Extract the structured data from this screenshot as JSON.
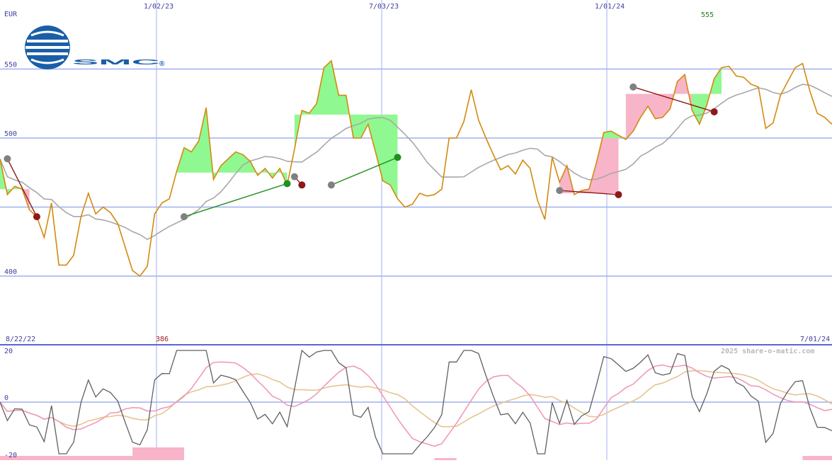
{
  "colors": {
    "price": "#d38a0e",
    "avg": "#a8a8a8",
    "up_fill": "#90f890",
    "down_fill": "#f8b4c8",
    "up_line": "#209020",
    "down_line": "#901818",
    "grid": "#a0b0f0",
    "label_blue": "#4040a0",
    "osc_dark": "#606060",
    "osc_pink": "#f09ab8",
    "osc_tan": "#e6c490",
    "logo_blue": "#1a5ea8"
  },
  "header": {
    "currency": "EUR",
    "max_label": "555",
    "min_label": "386",
    "start_date": "8/22/22",
    "end_date": "7/01/24",
    "copyright": "2025 share-o-matic.com"
  },
  "logo": {
    "text": "SMC",
    "registered": "®"
  },
  "chart_data": [
    {
      "type": "line",
      "currency": "EUR",
      "x_range": [
        "2022-08-22",
        "2024-07-01"
      ],
      "x_ticks": [
        "1/02/23",
        "7/03/23",
        "1/01/24"
      ],
      "y_ticks": [
        400,
        450,
        500,
        550
      ],
      "y_tick_labels": [
        "400",
        "",
        "500",
        "550"
      ],
      "ylim": [
        350,
        600
      ],
      "grid": true,
      "series": [
        {
          "key": "price",
          "values": [
            [
              0,
              485
            ],
            [
              2,
              459
            ],
            [
              4,
              465
            ],
            [
              6,
              463
            ],
            [
              8,
              448
            ],
            [
              10,
              443
            ],
            [
              12,
              428
            ],
            [
              14,
              453
            ],
            [
              16,
              408
            ],
            [
              18,
              408
            ],
            [
              20,
              415
            ],
            [
              22,
              443
            ],
            [
              24,
              460
            ],
            [
              26,
              445
            ],
            [
              28,
              450
            ],
            [
              30,
              446
            ],
            [
              32,
              438
            ],
            [
              34,
              421
            ],
            [
              36,
              404
            ],
            [
              38,
              400
            ],
            [
              40,
              407
            ],
            [
              42,
              445
            ],
            [
              44,
              453
            ],
            [
              46,
              456
            ],
            [
              48,
              476
            ],
            [
              50,
              493
            ],
            [
              52,
              490
            ],
            [
              54,
              498
            ],
            [
              56,
              522
            ],
            [
              58,
              470
            ],
            [
              60,
              480
            ],
            [
              62,
              485
            ],
            [
              64,
              490
            ],
            [
              66,
              488
            ],
            [
              68,
              483
            ],
            [
              70,
              473
            ],
            [
              72,
              478
            ],
            [
              74,
              471
            ],
            [
              76,
              478
            ],
            [
              78,
              466
            ],
            [
              80,
              492
            ],
            [
              82,
              520
            ],
            [
              84,
              518
            ],
            [
              86,
              525
            ],
            [
              88,
              551
            ],
            [
              90,
              556
            ],
            [
              92,
              531
            ],
            [
              94,
              531
            ],
            [
              96,
              500
            ],
            [
              98,
              500
            ],
            [
              100,
              510
            ],
            [
              102,
              490
            ],
            [
              104,
              469
            ],
            [
              106,
              466
            ],
            [
              108,
              456
            ],
            [
              110,
              450
            ],
            [
              112,
              452
            ],
            [
              114,
              460
            ],
            [
              116,
              458
            ],
            [
              118,
              459
            ],
            [
              120,
              463
            ],
            [
              122,
              500
            ],
            [
              124,
              500
            ],
            [
              126,
              512
            ],
            [
              128,
              535
            ],
            [
              130,
              513
            ],
            [
              132,
              500
            ],
            [
              134,
              488
            ],
            [
              136,
              477
            ],
            [
              138,
              480
            ],
            [
              140,
              474
            ],
            [
              142,
              484
            ],
            [
              144,
              478
            ],
            [
              146,
              455
            ],
            [
              148,
              441
            ],
            [
              150,
              486
            ],
            [
              152,
              468
            ],
            [
              154,
              480
            ],
            [
              156,
              459
            ],
            [
              158,
              462
            ],
            [
              160,
              463
            ],
            [
              162,
              482
            ],
            [
              164,
              504
            ],
            [
              166,
              505
            ],
            [
              168,
              502
            ],
            [
              170,
              499
            ],
            [
              172,
              505
            ],
            [
              174,
              515
            ],
            [
              176,
              523
            ],
            [
              178,
              514
            ],
            [
              180,
              515
            ],
            [
              182,
              521
            ],
            [
              184,
              541
            ],
            [
              186,
              546
            ],
            [
              188,
              520
            ],
            [
              190,
              510
            ],
            [
              192,
              524
            ],
            [
              194,
              543
            ],
            [
              196,
              551
            ],
            [
              198,
              552
            ],
            [
              200,
              545
            ],
            [
              202,
              544
            ],
            [
              204,
              539
            ],
            [
              206,
              537
            ],
            [
              208,
              507
            ],
            [
              210,
              511
            ],
            [
              212,
              531
            ],
            [
              214,
              541
            ],
            [
              216,
              551
            ],
            [
              218,
              554
            ],
            [
              220,
              534
            ],
            [
              222,
              518
            ],
            [
              224,
              515
            ],
            [
              226,
              510
            ]
          ]
        },
        {
          "key": "avg",
          "values": []
        }
      ],
      "annotations": {
        "max": 555,
        "min": 386,
        "currency": "EUR"
      }
    },
    {
      "type": "line",
      "x_range": [
        "2022-08-22",
        "2024-07-01"
      ],
      "y_ticks": [
        -20,
        0,
        20
      ],
      "y_tick_labels": [
        "-20",
        "0",
        "20"
      ],
      "ylim": [
        -20,
        20
      ],
      "grid": true,
      "series": [
        {
          "key": "osc_dark"
        },
        {
          "key": "osc_pink"
        },
        {
          "key": "osc_tan"
        }
      ]
    }
  ]
}
